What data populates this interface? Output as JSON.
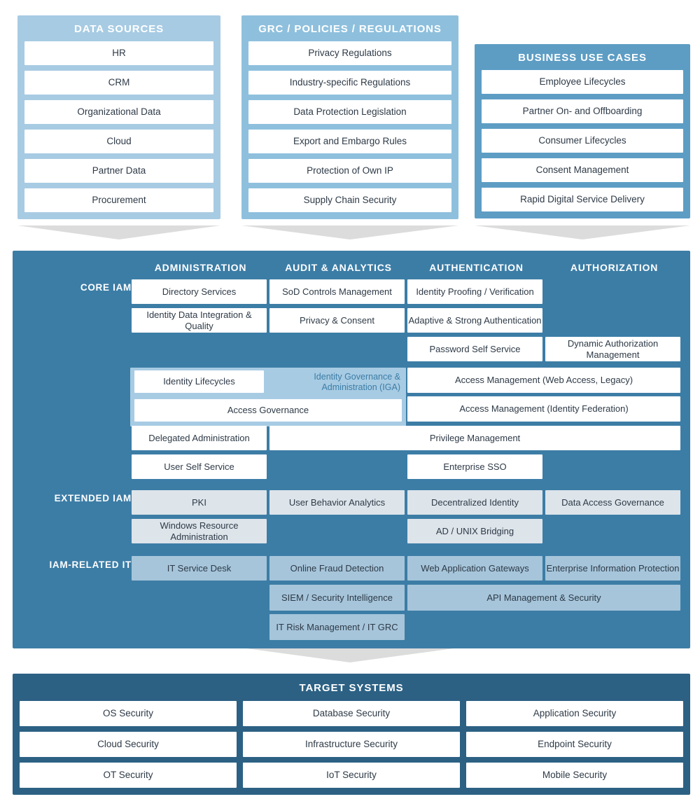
{
  "top_panels": [
    {
      "title": "DATA SOURCES",
      "items": [
        "HR",
        "CRM",
        "Organizational Data",
        "Cloud",
        "Partner Data",
        "Procurement"
      ]
    },
    {
      "title": "GRC / POLICIES / REGULATIONS",
      "items": [
        "Privacy Regulations",
        "Industry-specific Regulations",
        "Data Protection Legislation",
        "Export and Embargo Rules",
        "Protection of Own IP",
        "Supply Chain Security"
      ]
    },
    {
      "title": "BUSINESS USE CASES",
      "items": [
        "Employee Lifecycles",
        "Partner On- and Offboarding",
        "Consumer Lifecycles",
        "Consent Management",
        "Rapid Digital Service Delivery"
      ]
    }
  ],
  "core": {
    "column_headers": [
      "ADMINISTRATION",
      "AUDIT & ANALYTICS",
      "AUTHENTICATION",
      "AUTHORIZATION"
    ],
    "row_labels": [
      "CORE IAM",
      "EXTENDED IAM",
      "IAM-RELATED IT"
    ],
    "iga_group_label": "Identity Governance & Administration (IGA)",
    "boxes": [
      {
        "label": "Directory Services",
        "col": 1,
        "span": 1,
        "row": 1,
        "tier": "core"
      },
      {
        "label": "SoD Controls Management",
        "col": 2,
        "span": 1,
        "row": 1,
        "tier": "core"
      },
      {
        "label": "Identity Proofing / Verification",
        "col": 3,
        "span": 1,
        "row": 1,
        "tier": "core"
      },
      {
        "label": "Identity Data Integration & Quality",
        "col": 1,
        "span": 1,
        "row": 2,
        "tier": "core"
      },
      {
        "label": "Privacy & Consent",
        "col": 2,
        "span": 1,
        "row": 2,
        "tier": "core"
      },
      {
        "label": "Adaptive & Strong Authentication",
        "col": 3,
        "span": 1,
        "row": 2,
        "tier": "core"
      },
      {
        "label": "Password Self Service",
        "col": 3,
        "span": 1,
        "row": 3,
        "tier": "core"
      },
      {
        "label": "Dynamic Authorization Management",
        "col": 4,
        "span": 1,
        "row": 3,
        "tier": "core"
      },
      {
        "label": "Identity Lifecycles",
        "col": 1,
        "span": 1,
        "row": 4,
        "tier": "iga"
      },
      {
        "label": "Access Management (Web Access, Legacy)",
        "col": 3,
        "span": 2,
        "row": 4,
        "tier": "core"
      },
      {
        "label": "Access Governance",
        "col": 1,
        "span": 2,
        "row": 5,
        "tier": "iga"
      },
      {
        "label": "Access Management (Identity Federation)",
        "col": 3,
        "span": 2,
        "row": 5,
        "tier": "core"
      },
      {
        "label": "Delegated Administration",
        "col": 1,
        "span": 1,
        "row": 6,
        "tier": "core"
      },
      {
        "label": "Privilege Management",
        "col": 2,
        "span": 3,
        "row": 6,
        "tier": "core"
      },
      {
        "label": "User Self Service",
        "col": 1,
        "span": 1,
        "row": 7,
        "tier": "core"
      },
      {
        "label": "Enterprise SSO",
        "col": 3,
        "span": 1,
        "row": 7,
        "tier": "core"
      },
      {
        "label": "PKI",
        "col": 1,
        "span": 1,
        "row": 8,
        "tier": "extended"
      },
      {
        "label": "User Behavior Analytics",
        "col": 2,
        "span": 1,
        "row": 8,
        "tier": "extended"
      },
      {
        "label": "Decentralized Identity",
        "col": 3,
        "span": 1,
        "row": 8,
        "tier": "extended"
      },
      {
        "label": "Data Access Governance",
        "col": 4,
        "span": 1,
        "row": 8,
        "tier": "extended"
      },
      {
        "label": "Windows Resource Administration",
        "col": 1,
        "span": 1,
        "row": 9,
        "tier": "extended"
      },
      {
        "label": "AD / UNIX Bridging",
        "col": 3,
        "span": 1,
        "row": 9,
        "tier": "extended"
      },
      {
        "label": "IT Service Desk",
        "col": 1,
        "span": 1,
        "row": 10,
        "tier": "related"
      },
      {
        "label": "Online Fraud Detection",
        "col": 2,
        "span": 1,
        "row": 10,
        "tier": "related"
      },
      {
        "label": "Web Application Gateways",
        "col": 3,
        "span": 1,
        "row": 10,
        "tier": "related"
      },
      {
        "label": "Enterprise Information Protection",
        "col": 4,
        "span": 1,
        "row": 10,
        "tier": "related"
      },
      {
        "label": "SIEM / Security Intelligence",
        "col": 2,
        "span": 1,
        "row": 11,
        "tier": "related"
      },
      {
        "label": "API Management & Security",
        "col": 3,
        "span": 2,
        "row": 11,
        "tier": "related"
      },
      {
        "label": "IT Risk Management / IT GRC",
        "col": 2,
        "span": 1,
        "row": 12,
        "tier": "related"
      }
    ]
  },
  "target_systems": {
    "title": "TARGET SYSTEMS",
    "rows": [
      [
        "OS Security",
        "Database Security",
        "Application Security"
      ],
      [
        "Cloud Security",
        "Infrastructure Security",
        "Endpoint Security"
      ],
      [
        "OT Security",
        "IoT Security",
        "Mobile Security"
      ]
    ]
  },
  "colors": {
    "data_sources_bg": "#a7cbe3",
    "grc_bg": "#8ec0dd",
    "business_bg": "#5d9dc4",
    "core_bg": "#3c7da6",
    "target_bg": "#2c6184",
    "extended_tint": "#dde4ea",
    "related_tint": "#a6c5da",
    "arrow": "#dcdcdc",
    "cell_text": "#2e3a47"
  }
}
